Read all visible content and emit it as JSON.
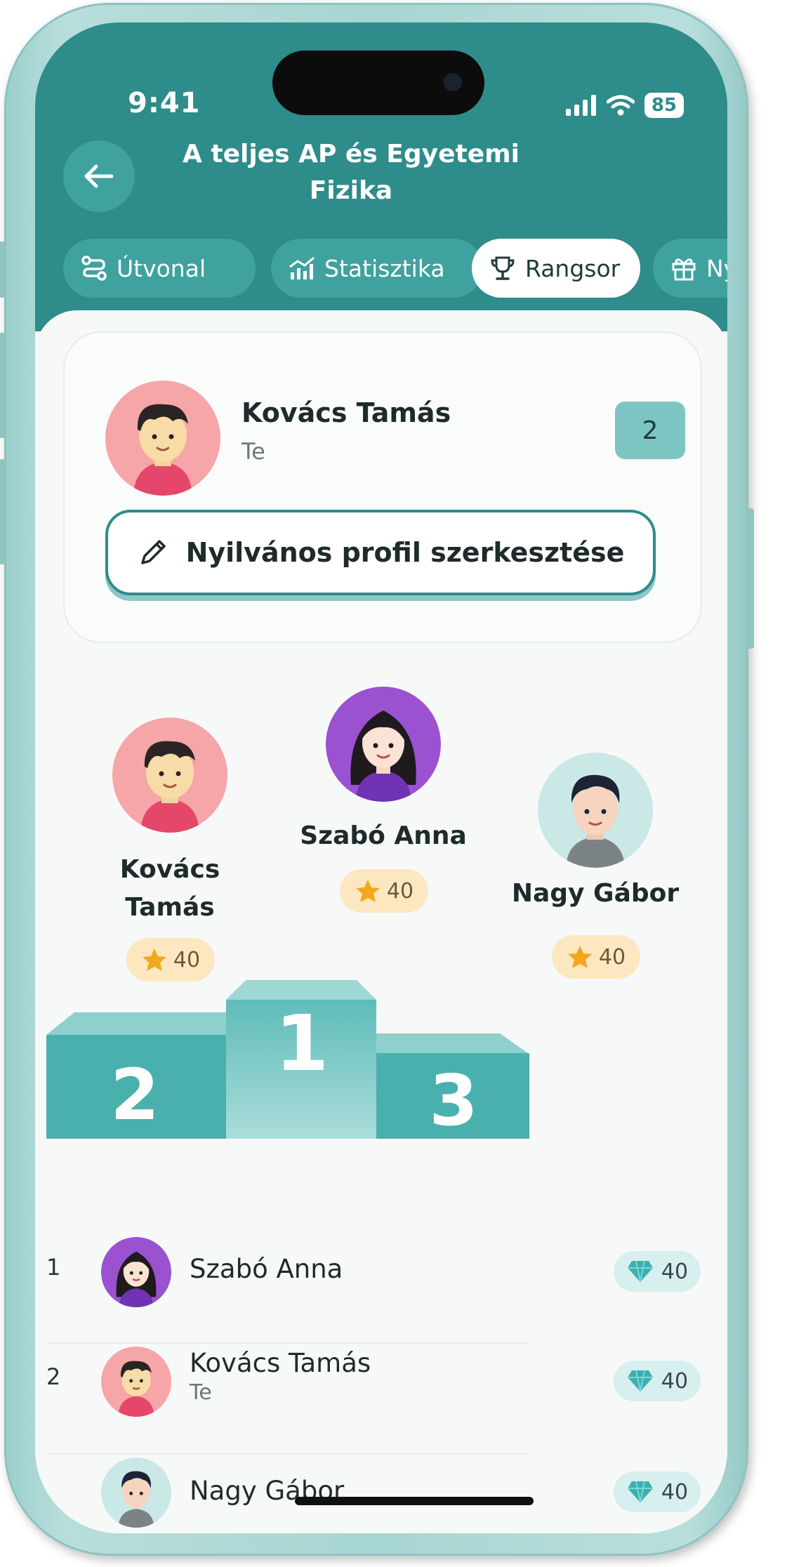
{
  "status_bar": {
    "time": "9:41",
    "battery": "85"
  },
  "header": {
    "title_line1": "A teljes AP és Egyetemi",
    "title_line2": "Fizika"
  },
  "tabs": [
    {
      "label": "Útvonal",
      "icon": "route-icon",
      "active": false
    },
    {
      "label": "Statisztika",
      "icon": "chart-icon",
      "active": false
    },
    {
      "label": "Rangsor",
      "icon": "trophy-icon",
      "active": true
    },
    {
      "label": "Nyer",
      "icon": "gift-icon",
      "active": false
    }
  ],
  "me_card": {
    "name": "Kovács Tamás",
    "subtitle": "Te",
    "rank": "2",
    "edit_button_label": "Nyilvános profil szerkesztése"
  },
  "podium": {
    "first": {
      "name": "Szabó Anna",
      "score": "40",
      "place": "1"
    },
    "second": {
      "name_line1": "Kovács",
      "name_line2": "Tamás",
      "score": "40",
      "place": "2"
    },
    "third": {
      "name": "Nagy Gábor",
      "score": "40",
      "place": "3"
    }
  },
  "leaderboard": [
    {
      "rank": "1",
      "name": "Szabó Anna",
      "subtitle": "",
      "score": "40"
    },
    {
      "rank": "2",
      "name": "Kovács Tamás",
      "subtitle": "Te",
      "score": "40"
    },
    {
      "rank": "",
      "name": "Nagy Gábor",
      "subtitle": "",
      "score": "40"
    }
  ],
  "colors": {
    "primary": "#2e8c8a",
    "tab_bg": "#3fa29f",
    "podium": "#49b0ad",
    "star_pill": "#fde7c0",
    "gem_pill": "#d7efee"
  }
}
